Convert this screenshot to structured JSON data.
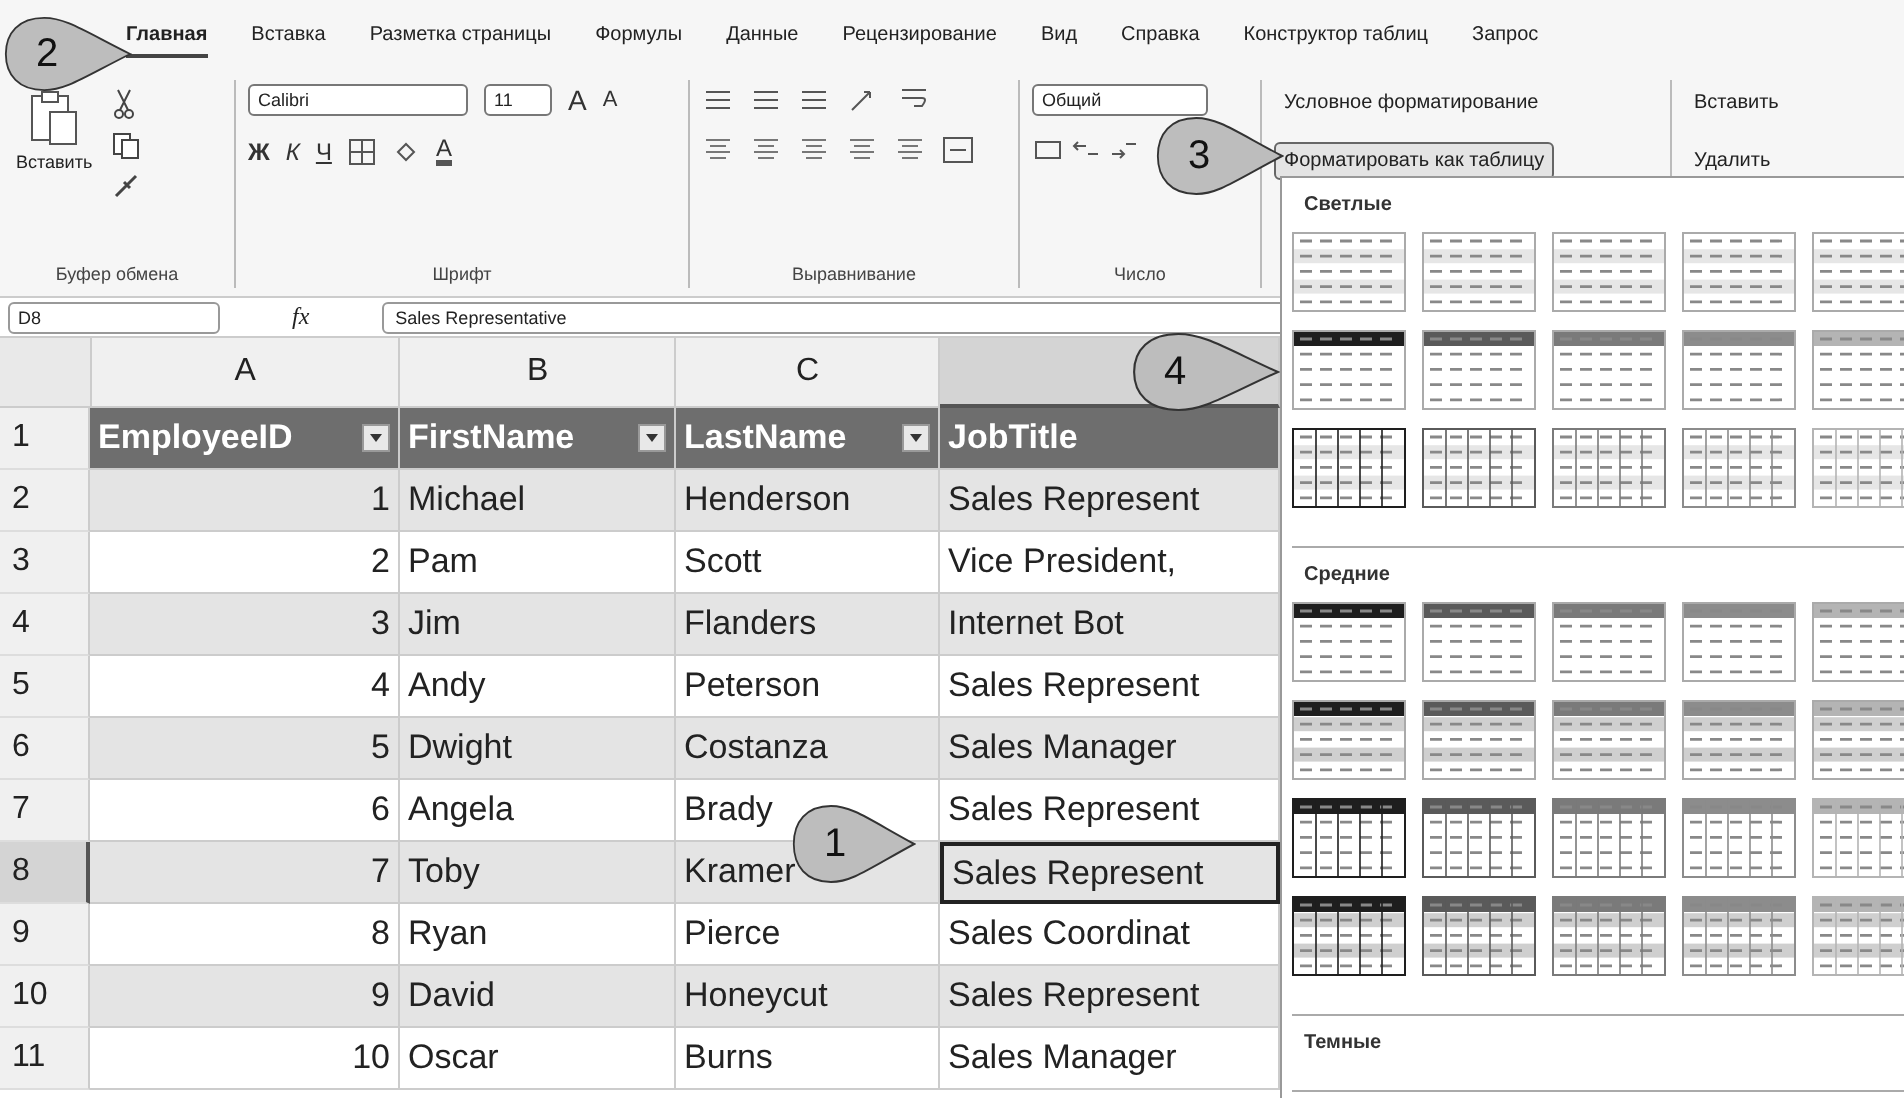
{
  "tabs": [
    {
      "label": "Главная",
      "selected": true
    },
    {
      "label": "Вставка",
      "selected": false
    },
    {
      "label": "Разметка страницы",
      "selected": false
    },
    {
      "label": "Формулы",
      "selected": false
    },
    {
      "label": "Данные",
      "selected": false
    },
    {
      "label": "Рецензирование",
      "selected": false
    },
    {
      "label": "Вид",
      "selected": false
    },
    {
      "label": "Справка",
      "selected": false
    },
    {
      "label": "Конструктор таблиц",
      "selected": false
    },
    {
      "label": "Запрос",
      "selected": false
    }
  ],
  "ribbon": {
    "clipboard": {
      "paste": "Вставить",
      "label": "Буфер обмена"
    },
    "font": {
      "family": "Calibri",
      "size": "11",
      "grow": "A",
      "shrink": "A",
      "bold": "Ж",
      "italic": "К",
      "underline": "Ч",
      "color_letter": "A",
      "label": "Шрифт"
    },
    "alignment": {
      "label": "Выравнивание"
    },
    "number": {
      "format": "Общий",
      "label": "Число"
    },
    "styles": {
      "conditional": "Условное форматирование",
      "format_table": "Форматировать как таблицу",
      "format_table_open": true
    },
    "cells": {
      "insert": "Вставить",
      "delete": "Удалить"
    }
  },
  "formula_bar": {
    "name_box": "D8",
    "fx": "fx",
    "value": "Sales Representative"
  },
  "columns": [
    {
      "letter": "A",
      "selected": false
    },
    {
      "letter": "B",
      "selected": false
    },
    {
      "letter": "C",
      "selected": false
    },
    {
      "selected": true
    }
  ],
  "rows": [
    {
      "number": "1",
      "kind": "header",
      "selected": false,
      "cells": [
        "EmployeeID",
        "FirstName",
        "LastName",
        "JobTitle"
      ]
    },
    {
      "number": "2",
      "kind": "data",
      "selected": false,
      "cells": [
        "1",
        "Michael",
        "Henderson",
        "Sales Represent"
      ]
    },
    {
      "number": "3",
      "kind": "data",
      "selected": false,
      "cells": [
        "2",
        "Pam",
        "Scott",
        "Vice President,"
      ]
    },
    {
      "number": "4",
      "kind": "data",
      "selected": false,
      "cells": [
        "3",
        "Jim",
        "Flanders",
        "Internet Bot"
      ]
    },
    {
      "number": "5",
      "kind": "data",
      "selected": false,
      "cells": [
        "4",
        "Andy",
        "Peterson",
        "Sales Represent"
      ]
    },
    {
      "number": "6",
      "kind": "data",
      "selected": false,
      "cells": [
        "5",
        "Dwight",
        "Costanza",
        "Sales Manager"
      ]
    },
    {
      "number": "7",
      "kind": "data",
      "selected": false,
      "cells": [
        "6",
        "Angela",
        "Brady",
        "Sales Represent"
      ]
    },
    {
      "number": "8",
      "kind": "data",
      "selected": true,
      "cells": [
        "7",
        "Toby",
        "Kramer",
        "Sales Represent"
      ]
    },
    {
      "number": "9",
      "kind": "data",
      "selected": false,
      "cells": [
        "8",
        "Ryan",
        "Pierce",
        "Sales Coordinat"
      ]
    },
    {
      "number": "10",
      "kind": "data",
      "selected": false,
      "cells": [
        "9",
        "David",
        "Honeycut",
        "Sales Represent"
      ]
    },
    {
      "number": "11",
      "kind": "data",
      "selected": false,
      "cells": [
        "10",
        "Oscar",
        "Burns",
        "Sales Manager"
      ]
    }
  ],
  "gallery": {
    "sections": [
      {
        "label": "Светлые",
        "rows": [
          {
            "kind": "lines"
          },
          {
            "kind": "header"
          },
          {
            "kind": "grid"
          }
        ]
      },
      {
        "label": "Средние",
        "rows": [
          {
            "kind": "header"
          },
          {
            "kind": "shaded"
          },
          {
            "kind": "header-grid"
          },
          {
            "kind": "shaded-grid"
          }
        ]
      },
      {
        "label": "Темные"
      }
    ]
  },
  "callouts": [
    {
      "label": "2"
    },
    {
      "label": "3"
    },
    {
      "label": "4"
    },
    {
      "label": "1"
    }
  ]
}
